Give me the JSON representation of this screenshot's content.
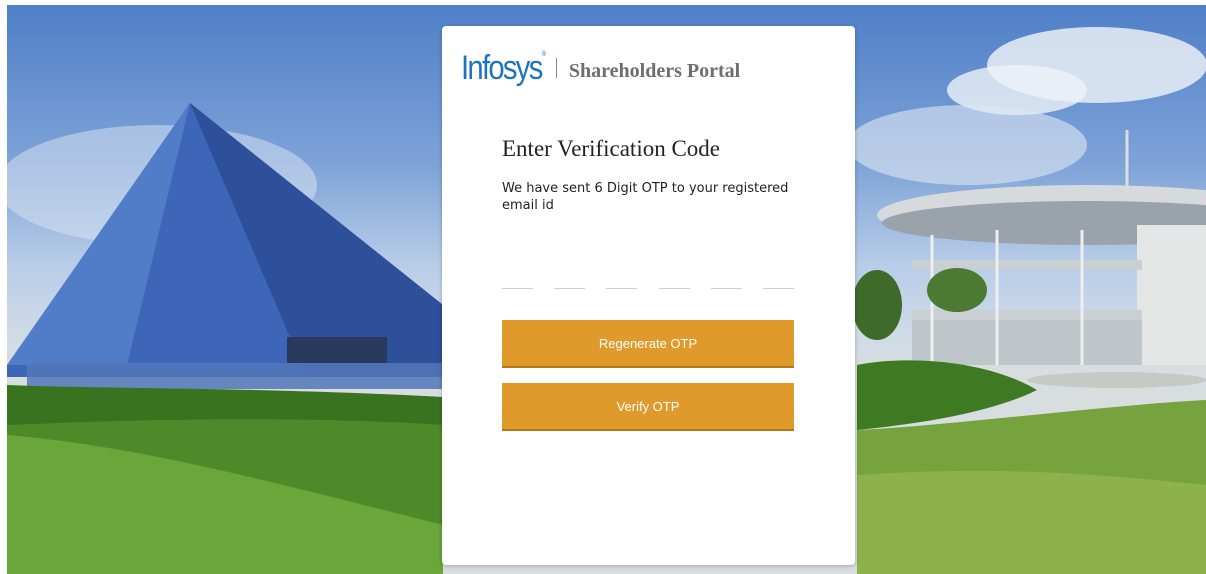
{
  "brand": {
    "logo_text": "Infosys",
    "logo_mark": "®",
    "portal_name": "Shareholders Portal"
  },
  "verification": {
    "title": "Enter Verification Code",
    "message": "We have sent 6 Digit OTP to your registered email id",
    "otp_digits": [
      "",
      "",
      "",
      "",
      "",
      ""
    ]
  },
  "actions": {
    "regenerate_label": "Regenerate OTP",
    "verify_label": "Verify OTP"
  },
  "colors": {
    "brand_blue": "#1c75bc",
    "button": "#e09a2b"
  }
}
